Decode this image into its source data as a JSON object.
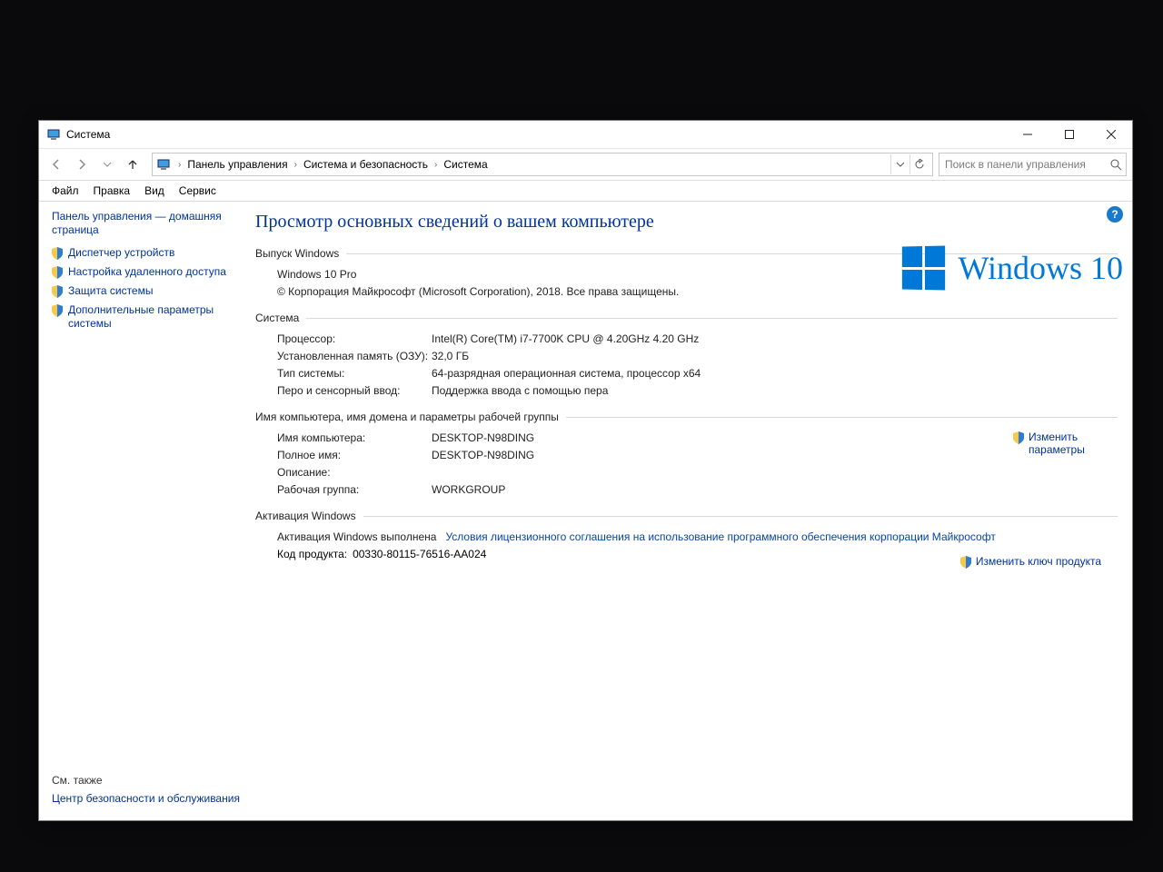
{
  "window": {
    "title": "Система"
  },
  "breadcrumb": {
    "item1": "Панель управления",
    "item2": "Система и безопасность",
    "item3": "Система"
  },
  "search": {
    "placeholder": "Поиск в панели управления"
  },
  "menu": {
    "file": "Файл",
    "edit": "Правка",
    "view": "Вид",
    "tools": "Сервис"
  },
  "sidebar": {
    "home": "Панель управления — домашняя страница",
    "dev": "Диспетчер устройств",
    "remote": "Настройка удаленного доступа",
    "protect": "Защита системы",
    "advanced": "Дополнительные параметры системы"
  },
  "heading": "Просмотр основных сведений о вашем компьютере",
  "edition": {
    "title": "Выпуск Windows",
    "name": "Windows 10 Pro",
    "copyright": "© Корпорация Майкрософт (Microsoft Corporation), 2018. Все права защищены."
  },
  "logo_text": "Windows 10",
  "system": {
    "title": "Система",
    "cpu_k": "Процессор:",
    "cpu_v": "Intel(R) Core(TM) i7-7700K CPU @ 4.20GHz   4.20 GHz",
    "ram_k": "Установленная память (ОЗУ):",
    "ram_v": "32,0 ГБ",
    "type_k": "Тип системы:",
    "type_v": "64-разрядная операционная система, процессор x64",
    "pen_k": "Перо и сенсорный ввод:",
    "pen_v": "Поддержка ввода с помощью пера"
  },
  "network": {
    "title": "Имя компьютера, имя домена и параметры рабочей группы",
    "name_k": "Имя компьютера:",
    "name_v": "DESKTOP-N98DING",
    "full_k": "Полное имя:",
    "full_v": "DESKTOP-N98DING",
    "desc_k": "Описание:",
    "desc_v": "",
    "wg_k": "Рабочая группа:",
    "wg_v": "WORKGROUP",
    "change": "Изменить параметры"
  },
  "activation": {
    "title": "Активация Windows",
    "status_k": "Активация Windows выполнена",
    "license": "Условия лицензионного соглашения на использование программного обеспечения корпорации Майкрософт",
    "pid_k": "Код продукта:",
    "pid_v": "00330-80115-76516-AA024",
    "change": "Изменить ключ продукта"
  },
  "seealso": {
    "title": "См. также",
    "sec": "Центр безопасности и обслуживания"
  }
}
